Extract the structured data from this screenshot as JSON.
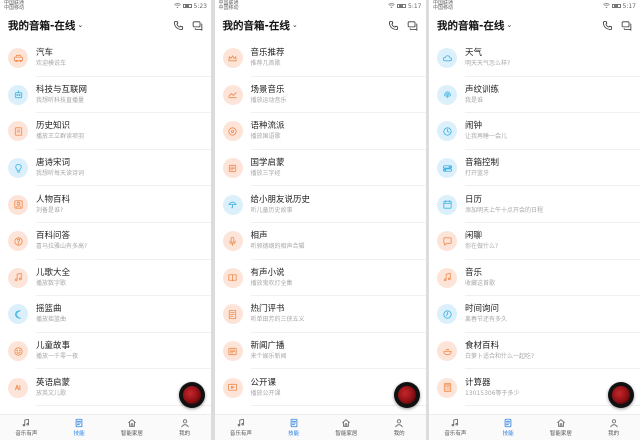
{
  "colors": {
    "accent": "#2a82e4",
    "icon_bg": "#fde4d8",
    "icon_fg": "#f08a4b",
    "icon_bg_blue": "#dcf0fb",
    "icon_fg_blue": "#3bb3e8"
  },
  "screens": [
    {
      "status": {
        "carrier1": "中国联通",
        "carrier2": "中国移动",
        "time": "5:23"
      },
      "header": {
        "title": "我的音箱-在线"
      },
      "items": [
        {
          "title": "汽车",
          "subtitle": "欢迎模说车",
          "icon": "car-icon"
        },
        {
          "title": "科技与互联网",
          "subtitle": "我想听科技直播量",
          "icon": "robot-icon"
        },
        {
          "title": "历史知识",
          "subtitle": "播放王立群读项羽",
          "icon": "book-icon"
        },
        {
          "title": "唐诗宋词",
          "subtitle": "我想听每天读诗词",
          "icon": "bulb-icon"
        },
        {
          "title": "人物百科",
          "subtitle": "刘备是谁?",
          "icon": "person-icon"
        },
        {
          "title": "百科问答",
          "subtitle": "喜马拉雅山有多高?",
          "icon": "question-icon"
        },
        {
          "title": "儿歌大全",
          "subtitle": "播放数字歌",
          "icon": "music-icon"
        },
        {
          "title": "摇篮曲",
          "subtitle": "播放摇篮曲",
          "icon": "moon-icon"
        },
        {
          "title": "儿童故事",
          "subtitle": "播放一千零一夜",
          "icon": "smile-icon"
        },
        {
          "title": "英语启蒙",
          "subtitle": "放英文儿歌",
          "icon": "abc-icon"
        }
      ],
      "nav": [
        {
          "label": "音乐有声",
          "icon": "music-note-icon"
        },
        {
          "label": "技能",
          "icon": "skill-icon",
          "active": true
        },
        {
          "label": "智能家居",
          "icon": "home-icon"
        },
        {
          "label": "我的",
          "icon": "user-icon"
        }
      ]
    },
    {
      "status": {
        "carrier1": "中国联通",
        "carrier2": "中国移动",
        "time": "5:17"
      },
      "header": {
        "title": "我的音箱-在线"
      },
      "items": [
        {
          "title": "音乐推荐",
          "subtitle": "推荐几首歌",
          "icon": "crown-icon"
        },
        {
          "title": "场景音乐",
          "subtitle": "播放运动音乐",
          "icon": "scene-icon"
        },
        {
          "title": "语种流派",
          "subtitle": "播放国语歌",
          "icon": "vinyl-icon"
        },
        {
          "title": "国学启蒙",
          "subtitle": "播放三字经",
          "icon": "scroll-icon"
        },
        {
          "title": "给小朋友说历史",
          "subtitle": "听儿童历史故事",
          "icon": "umbrella-icon"
        },
        {
          "title": "相声",
          "subtitle": "听郭德纲的相声合辑",
          "icon": "mic-icon"
        },
        {
          "title": "有声小说",
          "subtitle": "播放鬼吹灯全集",
          "icon": "novel-icon"
        },
        {
          "title": "热门评书",
          "subtitle": "听单田芳的三侠五义",
          "icon": "doc-icon"
        },
        {
          "title": "新闻广播",
          "subtitle": "来个娱乐新闻",
          "icon": "news-icon"
        },
        {
          "title": "公开课",
          "subtitle": "播放公开课",
          "icon": "play-icon"
        }
      ],
      "nav": [
        {
          "label": "音乐有声",
          "icon": "music-note-icon"
        },
        {
          "label": "技能",
          "icon": "skill-icon",
          "active": true
        },
        {
          "label": "智能家居",
          "icon": "home-icon"
        },
        {
          "label": "我的",
          "icon": "user-icon"
        }
      ]
    },
    {
      "status": {
        "carrier1": "中国联通",
        "carrier2": "中国移动",
        "time": "5:17"
      },
      "header": {
        "title": "我的音箱-在线"
      },
      "items": [
        {
          "title": "天气",
          "subtitle": "明天天气怎么样?",
          "icon": "cloud-icon"
        },
        {
          "title": "声纹训练",
          "subtitle": "我是谁",
          "icon": "fingerprint-icon"
        },
        {
          "title": "闹钟",
          "subtitle": "让我再睡一会儿",
          "icon": "clock-icon"
        },
        {
          "title": "音箱控制",
          "subtitle": "打开蓝牙",
          "icon": "toggle-icon"
        },
        {
          "title": "日历",
          "subtitle": "添加明天上午十点开会的日程",
          "icon": "calendar-icon"
        },
        {
          "title": "闲聊",
          "subtitle": "你在做什么?",
          "icon": "chat-icon"
        },
        {
          "title": "音乐",
          "subtitle": "收藏这首歌",
          "icon": "music-icon"
        },
        {
          "title": "时间询问",
          "subtitle": "离春节还有多久",
          "icon": "time-icon"
        },
        {
          "title": "食材百科",
          "subtitle": "白萝卜适合和什么一起吃?",
          "icon": "food-icon"
        },
        {
          "title": "计算器",
          "subtitle": "13015306等于多少",
          "icon": "calc-icon"
        }
      ],
      "nav": [
        {
          "label": "音乐有声",
          "icon": "music-note-icon"
        },
        {
          "label": "技能",
          "icon": "skill-icon",
          "active": true
        },
        {
          "label": "智能家居",
          "icon": "home-icon"
        },
        {
          "label": "我的",
          "icon": "user-icon"
        }
      ]
    }
  ]
}
